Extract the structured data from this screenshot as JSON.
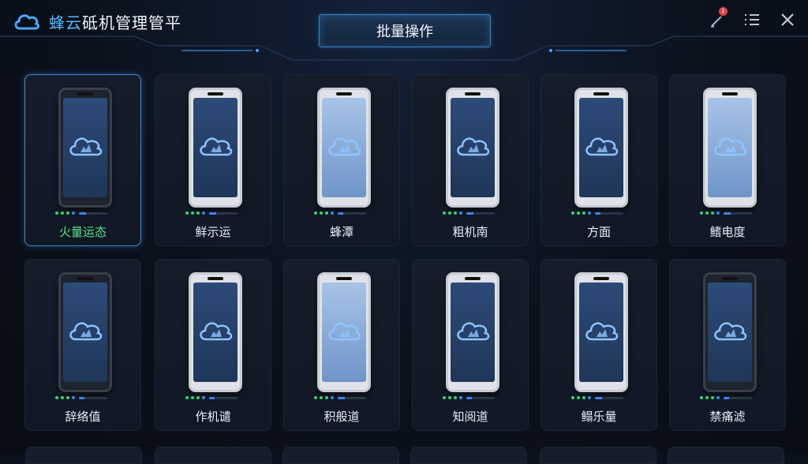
{
  "header": {
    "title_prefix": "蜂云",
    "title_rest": "砥机管理管平",
    "batch_button": "批量操作",
    "notification_count": "1",
    "icons": [
      "cloud-logo-icon",
      "notification-icon",
      "list-icon",
      "close-icon"
    ]
  },
  "colors": {
    "accent": "#3d86e6",
    "online": "#3fcf6e",
    "selected_label": "#5be38a",
    "border_selected": "#3f8ad6"
  },
  "devices": [
    {
      "label": "火量运态",
      "selected": true,
      "style": "dark",
      "progress": 0.25
    },
    {
      "label": "鲜示运",
      "selected": false,
      "style": "silver",
      "progress": 0.25
    },
    {
      "label": "蜂潭",
      "selected": false,
      "style": "light",
      "progress": 0.2
    },
    {
      "label": "粗机南",
      "selected": false,
      "style": "silver",
      "progress": 0.25
    },
    {
      "label": "方面",
      "selected": false,
      "style": "silver",
      "progress": 0.2
    },
    {
      "label": "鳍电度",
      "selected": false,
      "style": "light",
      "progress": 0.25
    },
    {
      "label": "辞络值",
      "selected": false,
      "style": "dark",
      "progress": 0.2
    },
    {
      "label": "作机谴",
      "selected": false,
      "style": "silver",
      "progress": 0.2
    },
    {
      "label": "积般道",
      "selected": false,
      "style": "light",
      "progress": 0.25
    },
    {
      "label": "知阅道",
      "selected": false,
      "style": "silver",
      "progress": 0.2
    },
    {
      "label": "鳎乐量",
      "selected": false,
      "style": "silver",
      "progress": 0.25
    },
    {
      "label": "禁痛滤",
      "selected": false,
      "style": "dark",
      "progress": 0.2
    }
  ]
}
